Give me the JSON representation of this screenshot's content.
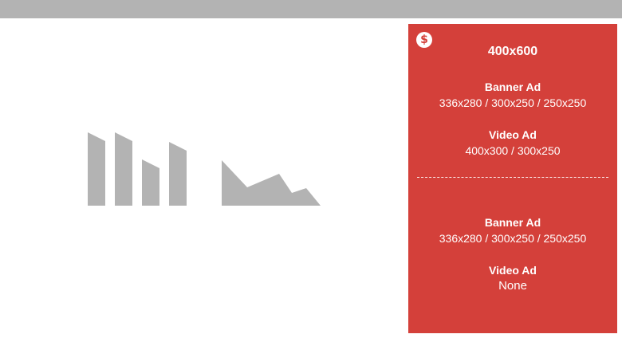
{
  "panel": {
    "color": "#d4403a",
    "icon": "dollar-icon",
    "icon_glyph": "$",
    "title": "400x600",
    "top_section": {
      "banner": {
        "label": "Banner Ad",
        "sizes": "336x280 / 300x250 / 250x250"
      },
      "video": {
        "label": "Video Ad",
        "sizes": "400x300 / 300x250"
      }
    },
    "bottom_section": {
      "banner": {
        "label": "Banner Ad",
        "sizes": "336x280 / 300x250 / 250x250"
      },
      "video": {
        "label": "Video Ad",
        "sizes": "None"
      }
    }
  },
  "colors": {
    "top_bar": "#b3b3b3",
    "illustration": "#b3b3b3"
  }
}
